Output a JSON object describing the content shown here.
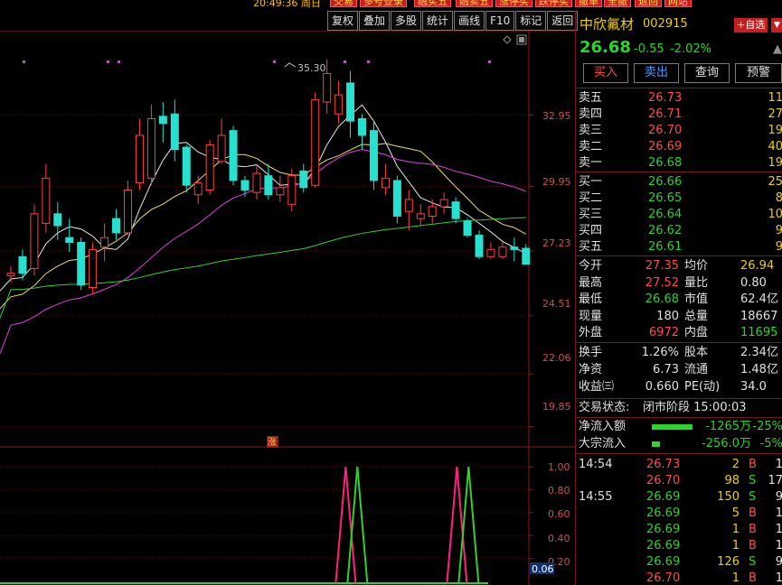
{
  "topbar": {
    "time": "20:49:36 周日",
    "buttons": [
      "交易",
      "多号登录",
      "融买五",
      "融卖五",
      "涨停买",
      "跌停买",
      "撤单",
      "全撤",
      "返回",
      "网站"
    ]
  },
  "toolbar": [
    "复权",
    "叠加",
    "多股",
    "统计",
    "画线",
    "F10",
    "标记",
    "返回"
  ],
  "chart": {
    "peak_label": "35.30",
    "price_ticks": [
      "32.95",
      "29.95",
      "27.23",
      "24.51",
      "22.06",
      "19.85"
    ],
    "indicator_ticks": [
      "1.00",
      "0.80",
      "0.60",
      "0.40",
      "0.20"
    ],
    "indicator_value": "0.06",
    "zhang_marker": "涨"
  },
  "chart_data": {
    "type": "candlestick",
    "candles": [
      {
        "o": 26.2,
        "c": 26.3,
        "h": 26.6,
        "l": 25.9
      },
      {
        "o": 27.0,
        "c": 26.3,
        "h": 27.3,
        "l": 26.0
      },
      {
        "o": 26.5,
        "c": 28.8,
        "h": 29.2,
        "l": 26.2
      },
      {
        "o": 28.4,
        "c": 30.3,
        "h": 30.9,
        "l": 28.0
      },
      {
        "o": 28.8,
        "c": 28.3,
        "h": 29.3,
        "l": 27.7
      },
      {
        "o": 27.8,
        "c": 27.6,
        "h": 28.6,
        "l": 27.2
      },
      {
        "o": 27.6,
        "c": 25.8,
        "h": 27.8,
        "l": 25.6
      },
      {
        "o": 25.7,
        "c": 27.3,
        "h": 27.6,
        "l": 25.4
      },
      {
        "o": 27.4,
        "c": 27.8,
        "h": 28.4,
        "l": 26.8
      },
      {
        "o": 28.6,
        "c": 28.0,
        "h": 29.0,
        "l": 27.7
      },
      {
        "o": 28.0,
        "c": 29.8,
        "h": 30.2,
        "l": 27.9
      },
      {
        "o": 30.1,
        "c": 32.1,
        "h": 32.8,
        "l": 29.8
      },
      {
        "o": 30.3,
        "c": 32.8,
        "h": 33.4,
        "l": 30.0
      },
      {
        "o": 32.9,
        "c": 32.6,
        "h": 33.5,
        "l": 31.8
      },
      {
        "o": 33.0,
        "c": 31.5,
        "h": 33.6,
        "l": 31.0
      },
      {
        "o": 31.6,
        "c": 30.0,
        "h": 31.7,
        "l": 29.7
      },
      {
        "o": 29.6,
        "c": 30.1,
        "h": 30.4,
        "l": 29.2
      },
      {
        "o": 29.8,
        "c": 31.7,
        "h": 31.9,
        "l": 29.6
      },
      {
        "o": 31.0,
        "c": 32.1,
        "h": 32.8,
        "l": 30.9
      },
      {
        "o": 32.3,
        "c": 30.2,
        "h": 32.5,
        "l": 30.0
      },
      {
        "o": 30.2,
        "c": 29.8,
        "h": 30.4,
        "l": 29.5
      },
      {
        "o": 29.7,
        "c": 30.5,
        "h": 30.8,
        "l": 29.4
      },
      {
        "o": 30.4,
        "c": 29.6,
        "h": 30.9,
        "l": 29.4
      },
      {
        "o": 29.6,
        "c": 29.9,
        "h": 30.4,
        "l": 29.3
      },
      {
        "o": 29.2,
        "c": 30.4,
        "h": 30.7,
        "l": 28.9
      },
      {
        "o": 30.6,
        "c": 29.9,
        "h": 30.9,
        "l": 29.7
      },
      {
        "o": 30.0,
        "c": 33.6,
        "h": 33.9,
        "l": 29.9
      },
      {
        "o": 33.5,
        "c": 34.7,
        "h": 35.3,
        "l": 33.0
      },
      {
        "o": 33.0,
        "c": 33.8,
        "h": 34.4,
        "l": 32.6
      },
      {
        "o": 34.3,
        "c": 32.7,
        "h": 34.8,
        "l": 32.0
      },
      {
        "o": 32.8,
        "c": 32.1,
        "h": 33.0,
        "l": 31.5
      },
      {
        "o": 32.3,
        "c": 30.2,
        "h": 32.7,
        "l": 29.8
      },
      {
        "o": 29.9,
        "c": 30.3,
        "h": 30.9,
        "l": 29.6
      },
      {
        "o": 30.2,
        "c": 28.7,
        "h": 30.4,
        "l": 28.4
      },
      {
        "o": 28.9,
        "c": 29.4,
        "h": 29.8,
        "l": 28.1
      },
      {
        "o": 28.6,
        "c": 28.8,
        "h": 29.2,
        "l": 28.3
      },
      {
        "o": 28.7,
        "c": 29.1,
        "h": 29.4,
        "l": 28.4
      },
      {
        "o": 29.1,
        "c": 29.4,
        "h": 29.7,
        "l": 28.8
      },
      {
        "o": 29.3,
        "c": 28.6,
        "h": 29.5,
        "l": 28.4
      },
      {
        "o": 28.5,
        "c": 27.9,
        "h": 28.6,
        "l": 27.8
      },
      {
        "o": 27.9,
        "c": 27.0,
        "h": 28.1,
        "l": 26.9
      },
      {
        "o": 27.0,
        "c": 27.3,
        "h": 27.6,
        "l": 26.9
      },
      {
        "o": 27.0,
        "c": 27.4,
        "h": 27.6,
        "l": 26.9
      },
      {
        "o": 27.4,
        "c": 27.3,
        "h": 27.8,
        "l": 26.8
      },
      {
        "o": 27.35,
        "c": 26.68,
        "h": 27.52,
        "l": 26.68
      }
    ],
    "ylim": [
      19.0,
      36.5
    ],
    "indicator_spikes": [
      {
        "series": "magenta",
        "index": 28.6
      },
      {
        "series": "green",
        "index": 29.6
      },
      {
        "series": "magenta",
        "index": 38.1
      },
      {
        "series": "green",
        "index": 39.1
      }
    ]
  },
  "stock": {
    "name": "中欣氟材",
    "code": "002915",
    "add_fav": "+自选",
    "price": "26.68",
    "change": "-0.55",
    "change_pct": "-2.02%"
  },
  "actions": [
    "买入",
    "卖出",
    "查询",
    "预警"
  ],
  "asks": [
    {
      "label": "卖五",
      "price": "26.73",
      "vol": "11"
    },
    {
      "label": "卖四",
      "price": "26.71",
      "vol": "27"
    },
    {
      "label": "卖三",
      "price": "26.70",
      "vol": "19"
    },
    {
      "label": "卖二",
      "price": "26.69",
      "vol": "40"
    },
    {
      "label": "卖一",
      "price": "26.68",
      "vol": "19"
    }
  ],
  "bids": [
    {
      "label": "买一",
      "price": "26.66",
      "vol": "25"
    },
    {
      "label": "买二",
      "price": "26.65",
      "vol": "8"
    },
    {
      "label": "买三",
      "price": "26.64",
      "vol": "10"
    },
    {
      "label": "买四",
      "price": "26.62",
      "vol": "9"
    },
    {
      "label": "买五",
      "price": "26.61",
      "vol": "9"
    }
  ],
  "stats": [
    {
      "l1": "今开",
      "v1": "27.35",
      "c1": "cr",
      "l2": "均价",
      "v2": "26.94",
      "c2": "cy"
    },
    {
      "l1": "最高",
      "v1": "27.52",
      "c1": "cr",
      "l2": "量比",
      "v2": "0.80",
      "c2": "cw"
    },
    {
      "l1": "最低",
      "v1": "26.68",
      "c1": "cg",
      "l2": "市值",
      "v2": "62.4亿",
      "c2": "cw"
    },
    {
      "l1": "现量",
      "v1": "180",
      "c1": "cw",
      "l2": "总量",
      "v2": "18667",
      "c2": "cw"
    },
    {
      "l1": "外盘",
      "v1": "6972",
      "c1": "cr",
      "l2": "内盘",
      "v2": "11695",
      "c2": "cg"
    }
  ],
  "stats2": [
    {
      "l1": "换手",
      "v1": "1.26%",
      "l2": "股本",
      "v2": "2.34亿"
    },
    {
      "l1": "净资",
      "v1": "6.73",
      "l2": "流通",
      "v2": "1.48亿"
    },
    {
      "l1": "收益㈢",
      "v1": "0.660",
      "l2": "PE(动)",
      "v2": "34.0"
    }
  ],
  "trade_status": {
    "label": "交易状态:",
    "value": "闭市阶段 15:00:03"
  },
  "flows": [
    {
      "label": "净流入额",
      "value": "-1265万",
      "pct": "-25%",
      "bar": 0.25
    },
    {
      "label": "大宗流入",
      "value": "-256.0万",
      "pct": "-5%",
      "bar": 0.05
    }
  ],
  "ticks": [
    {
      "time": "14:54",
      "price": "26.73",
      "vol": "2",
      "side": "B",
      "n": "1"
    },
    {
      "time": "",
      "price": "26.70",
      "vol": "98",
      "side": "S",
      "n": "17"
    },
    {
      "time": "14:55",
      "price": "26.69",
      "vol": "150",
      "side": "S",
      "n": "9"
    },
    {
      "time": "",
      "price": "26.69",
      "vol": "5",
      "side": "B",
      "n": "1"
    },
    {
      "time": "",
      "price": "26.69",
      "vol": "1",
      "side": "B",
      "n": "1"
    },
    {
      "time": "",
      "price": "26.69",
      "vol": "1",
      "side": "B",
      "n": "1"
    },
    {
      "time": "",
      "price": "26.69",
      "vol": "126",
      "side": "S",
      "n": "9"
    },
    {
      "time": "",
      "price": "26.70",
      "vol": "1",
      "side": "B",
      "n": "1"
    }
  ],
  "colors": {
    "up": "#ff4040",
    "down": "#27e0d0",
    "ma5": "#e8e8e8",
    "ma10": "#f0e060",
    "ma20": "#e040e0",
    "ma60": "#30d030"
  }
}
